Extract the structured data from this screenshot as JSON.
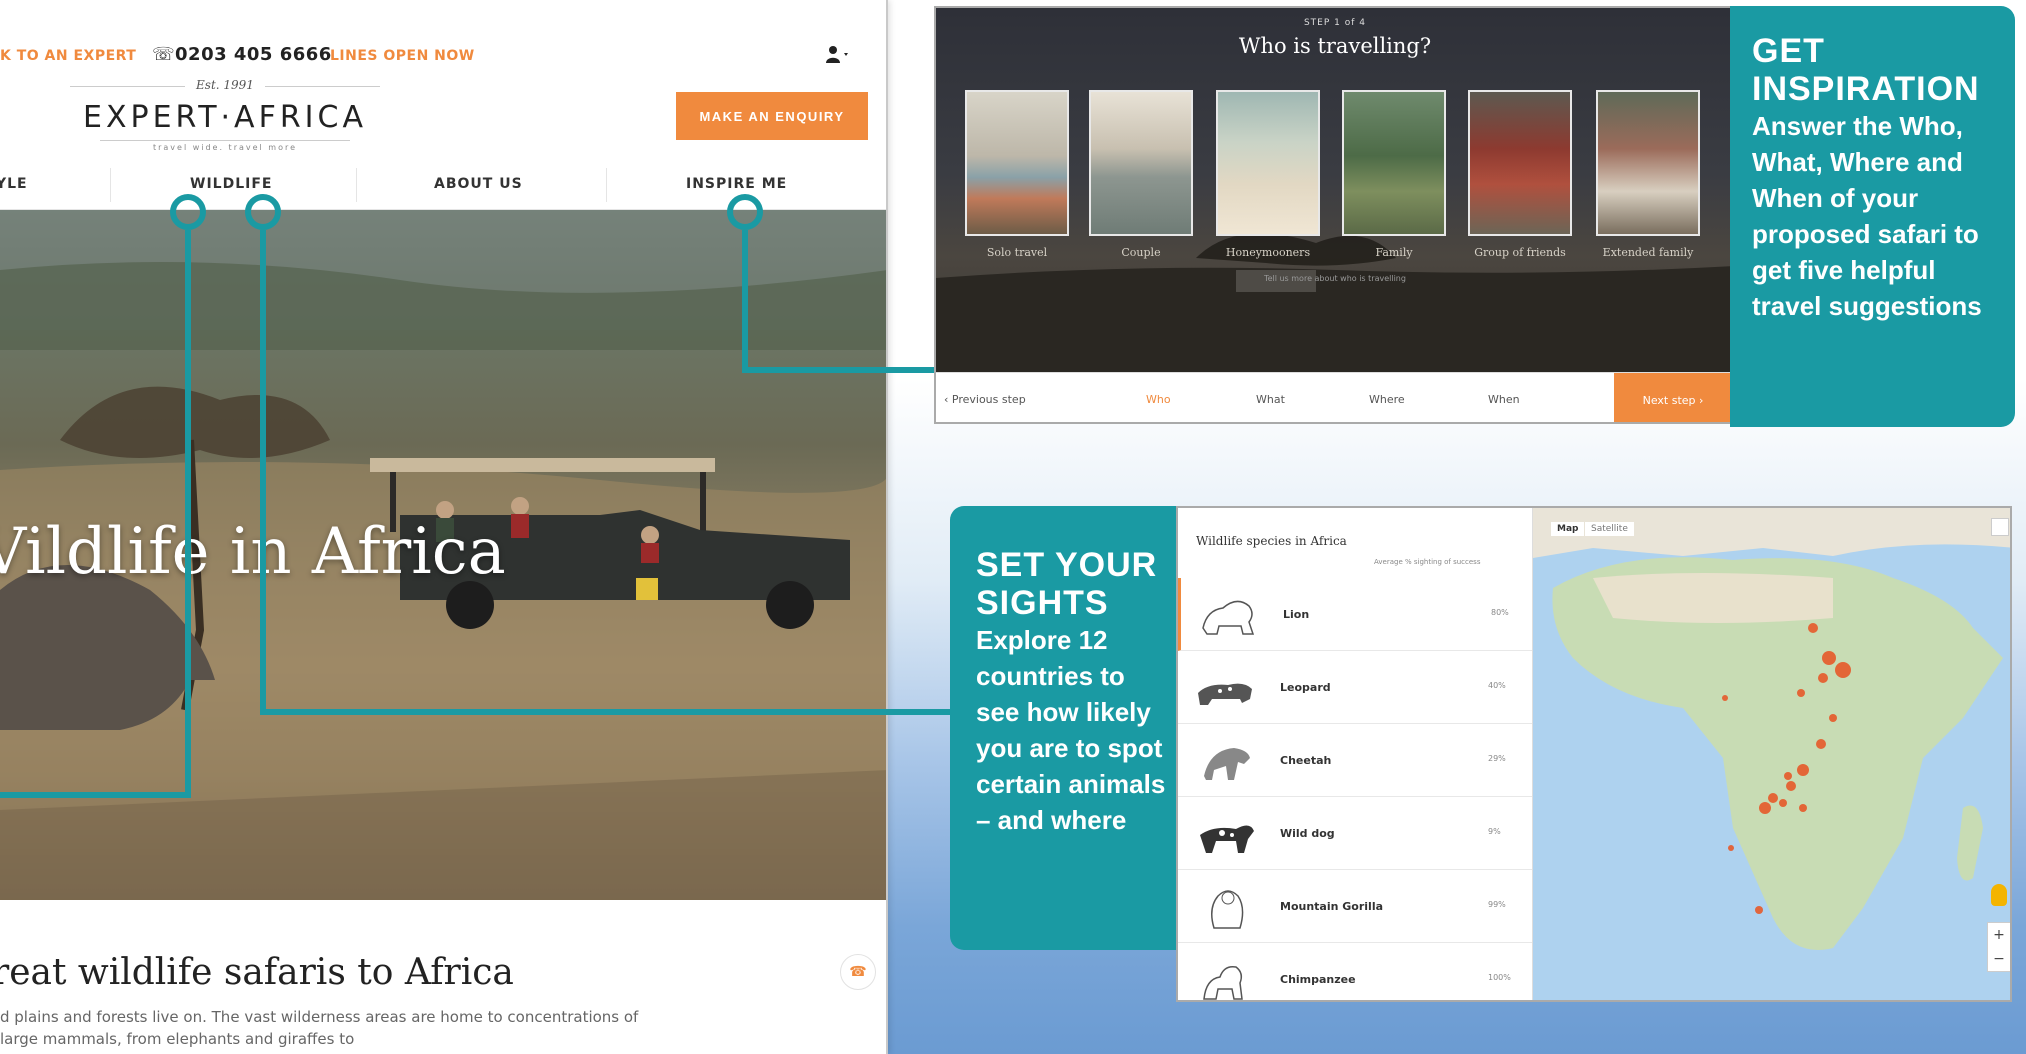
{
  "site": {
    "topbar": {
      "speak": "K TO AN EXPERT",
      "phone": "0203 405 6666",
      "lines": "LINES OPEN NOW"
    },
    "logo": {
      "est": "Est. 1991",
      "name": "EXPERT·AFRICA",
      "tagline": "travel wide. travel more"
    },
    "enquiry_button": "MAKE AN ENQUIRY",
    "nav": [
      "YLE",
      "WILDLIFE",
      "ABOUT US",
      "INSPIRE ME"
    ],
    "hero_title": "Vildlife in Africa",
    "section_title": "reat wildlife safaris to Africa",
    "section_text": "d plains and forests live on. The vast wilderness areas are home to concentrations of large mammals, from elephants and giraffes to"
  },
  "inspiration_panel": {
    "step": "STEP 1 of 4",
    "title": "Who is travelling?",
    "cards": [
      {
        "label": "Solo travel"
      },
      {
        "label": "Couple"
      },
      {
        "label": "Honeymooners"
      },
      {
        "label": "Family"
      },
      {
        "label": "Group of friends"
      },
      {
        "label": "Extended family"
      }
    ],
    "subtext": "Tell us more about who is travelling",
    "nav": {
      "previous": "‹  Previous step",
      "tabs": [
        "Who",
        "What",
        "Where",
        "When"
      ],
      "next": "Next step  ›"
    }
  },
  "callout_inspiration": {
    "heading": "GET INSPIRATION",
    "text": "Answer the Who, What, Where and When of your proposed safari to get five helpful travel suggestions"
  },
  "callout_sights": {
    "heading": "SET YOUR SIGHTS",
    "text": "Explore 12 countries to see how likely you are to spot certain animals",
    "text2": "– and where"
  },
  "wildlife_panel": {
    "title": "Wildlife species in Africa",
    "subtitle": "Average % sighting of success",
    "species": [
      {
        "name": "Lion",
        "pct": "80%",
        "icon": "lion-icon"
      },
      {
        "name": "Leopard",
        "pct": "40%",
        "icon": "leopard-icon"
      },
      {
        "name": "Cheetah",
        "pct": "29%",
        "icon": "cheetah-icon"
      },
      {
        "name": "Wild dog",
        "pct": "9%",
        "icon": "wild-dog-icon"
      },
      {
        "name": "Mountain Gorilla",
        "pct": "99%",
        "icon": "gorilla-icon"
      },
      {
        "name": "Chimpanzee",
        "pct": "100%",
        "icon": "chimpanzee-icon"
      }
    ],
    "map_tabs": [
      "Map",
      "Satellite"
    ]
  },
  "colors": {
    "accent_orange": "#f08a3e",
    "teal": "#1a9aa3"
  }
}
